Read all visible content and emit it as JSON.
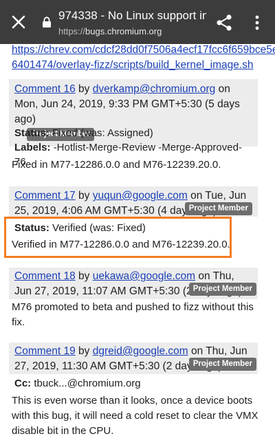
{
  "browser": {
    "title": "974338 - No Linux support in...",
    "url_scheme": "https://",
    "url_host": "bugs.chromium.org"
  },
  "url_tail": {
    "line1": "https://chrev.com/cdcf28dd0f7506a4ecf17fcc6f659bce5ef",
    "line2": "6401474/overlay-fizz/scripts/build_kernel_image.sh"
  },
  "comments": [
    {
      "link": "Comment 16",
      "by": "by",
      "author": "dverkamp@chromium.org",
      "date": "on Mon, Jun 24, 2019, 9:33 PM GMT+5:30 (5 days ago)",
      "badge": "Project Member",
      "status_label": "Status:",
      "status_value": "Fixed (was: Assigned)",
      "labels_label": "Labels:",
      "labels_value": "-Hotlist-Merge-Review -Merge-Approved-76",
      "body": "Fixed in M77-12286.0.0 and M76-12239.20.0."
    },
    {
      "link": "Comment 17",
      "by": "by",
      "author": "yuqun@google.com",
      "date": "on Tue, Jun 25, 2019, 4:06 AM GMT+5:30 (4 days ago)",
      "badge": "Project Member",
      "status_label": "Status:",
      "status_value": "Verified (was: Fixed)",
      "body": "Verified in M77-12286.0.0 and M76-12239.20.0."
    },
    {
      "link": "Comment 18",
      "by": "by",
      "author": "uekawa@google.com",
      "date": "on Thu, Jun 27, 2019, 11:07 AM GMT+5:30 (2 days ago)",
      "badge": "Project Member",
      "body": "M76 promoted to beta and pushed to fizz without this fix."
    },
    {
      "link": "Comment 19",
      "by": "by",
      "author": "dgreid@google.com",
      "date": "on Thu, Jun 27, 2019, 11:30 AM GMT+5:30 (2 days ago)",
      "badge": "Project Member",
      "cc_label": "Cc:",
      "cc_value": "tbuck...@chromium.org",
      "body": "This is even worse than it looks, once a device boots with this bug, it will need a cold reset to clear the VMX disable bit in the CPU."
    }
  ],
  "colors": {
    "toolbar": "#3c3c3c",
    "link": "#1a3fb5",
    "header_bg": "#ececec",
    "badge_bg": "#6d6d6d",
    "highlight": "#f57c22"
  },
  "icons": [
    "close-icon",
    "lock-icon",
    "share-icon",
    "overflow-menu-icon"
  ]
}
